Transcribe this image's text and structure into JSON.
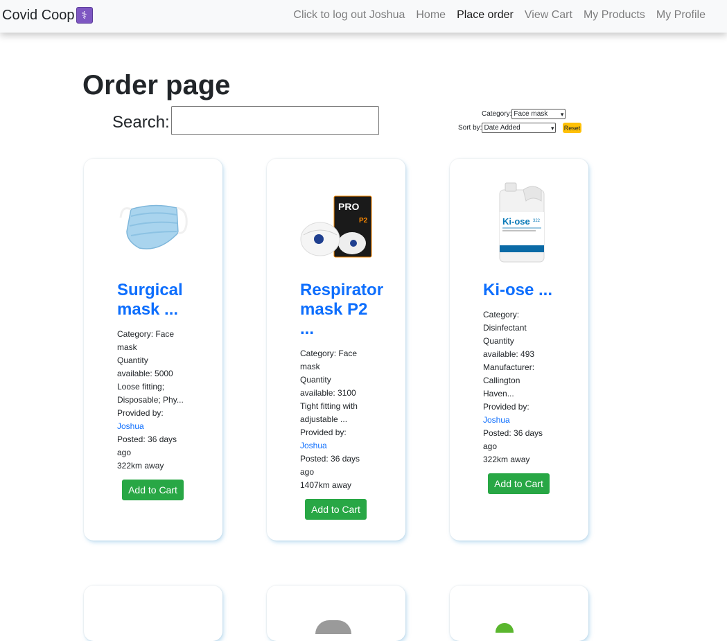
{
  "nav": {
    "brand": "Covid Coop",
    "brand_icon": "medical-caduceus-icon",
    "items": [
      {
        "label": "Click to log out Joshua"
      },
      {
        "label": "Home"
      },
      {
        "label": "Place order",
        "active": true
      },
      {
        "label": "View Cart"
      },
      {
        "label": "My Products"
      },
      {
        "label": "My Profile"
      }
    ]
  },
  "page": {
    "title": "Order page",
    "search_label": "Search:",
    "search_value": "",
    "category_label": "Category:",
    "category_value": "Face mask",
    "sort_label": "Sort by:",
    "sort_value": "Date Added",
    "reset_label": "Reset"
  },
  "products": [
    {
      "title1": "Surgical",
      "title2": "mask ...",
      "lines": [
        "Category: Face",
        "mask",
        "Quantity",
        "available: 5000",
        "Loose fitting;",
        "Disposable; Phy...",
        "Provided by:"
      ],
      "provider": "Joshua",
      "lines2": [
        "Posted: 36 days",
        "ago",
        "322km away"
      ],
      "button": "Add to Cart",
      "image": "surgical-mask-image"
    },
    {
      "title1": "Respirator",
      "title2": "mask P2",
      "title3": "...",
      "lines": [
        "Category: Face",
        "mask",
        "Quantity",
        "available: 3100",
        "Tight fitting with",
        "adjustable ...",
        "Provided by:"
      ],
      "provider": "Joshua",
      "lines2": [
        "Posted: 36 days",
        "ago",
        "1407km away"
      ],
      "button": "Add to Cart",
      "image": "respirator-p2-image"
    },
    {
      "title1": "Ki-ose ...",
      "lines": [
        "Category:",
        "Disinfectant",
        "Quantity",
        "available: 493",
        "Manufacturer:",
        "Callington",
        "Haven...",
        "Provided by:"
      ],
      "provider": "Joshua",
      "lines2": [
        "Posted: 36 days",
        "ago",
        "322km away"
      ],
      "button": "Add to Cart",
      "image": "disinfectant-bottle-image"
    }
  ],
  "colors": {
    "link": "#0d6efd",
    "button": "#28a745",
    "reset": "#ffc107"
  }
}
